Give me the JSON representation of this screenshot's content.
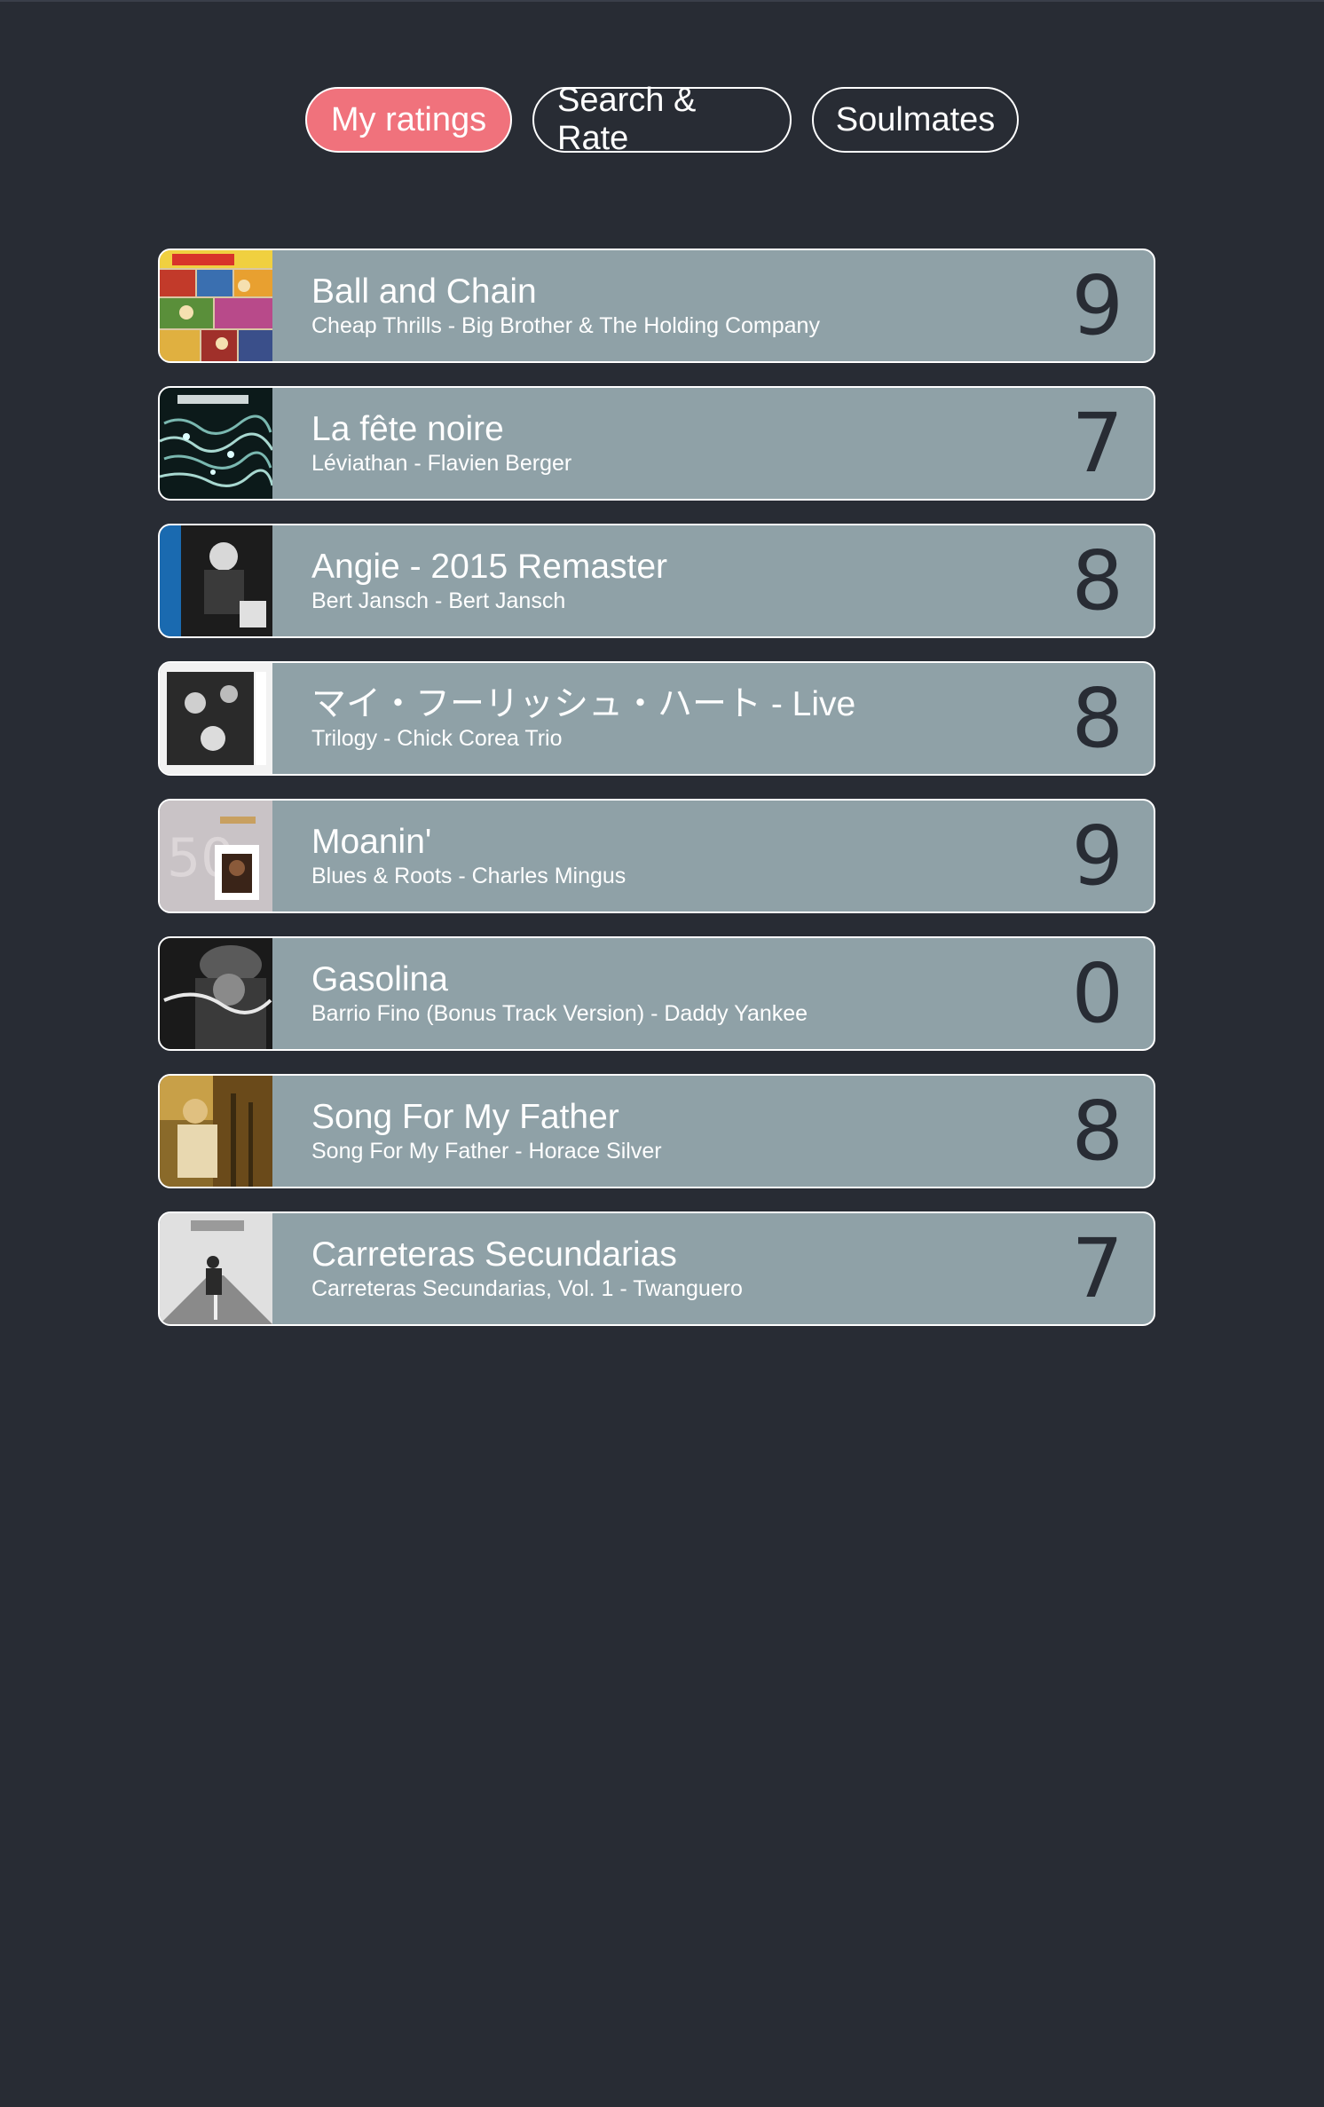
{
  "nav": {
    "tabs": [
      {
        "label": "My ratings",
        "active": true
      },
      {
        "label": "Search & Rate",
        "active": false
      },
      {
        "label": "Soulmates",
        "active": false
      }
    ]
  },
  "ratings": [
    {
      "title": "Ball and Chain",
      "album": "Cheap Thrills",
      "artist": "Big Brother & The Holding Company",
      "subtitle": "Cheap Thrills - Big Brother & The Holding Company",
      "rating": "9"
    },
    {
      "title": "La fête noire",
      "album": "Léviathan",
      "artist": "Flavien Berger",
      "subtitle": "Léviathan - Flavien Berger",
      "rating": "7"
    },
    {
      "title": "Angie - 2015 Remaster",
      "album": "Bert Jansch",
      "artist": "Bert Jansch",
      "subtitle": "Bert Jansch - Bert Jansch",
      "rating": "8"
    },
    {
      "title": "マイ・フーリッシュ・ハート - Live",
      "album": "Trilogy",
      "artist": "Chick Corea Trio",
      "subtitle": "Trilogy - Chick Corea Trio",
      "rating": "8"
    },
    {
      "title": "Moanin'",
      "album": "Blues & Roots",
      "artist": "Charles Mingus",
      "subtitle": "Blues & Roots - Charles Mingus",
      "rating": "9"
    },
    {
      "title": "Gasolina",
      "album": "Barrio Fino (Bonus Track Version)",
      "artist": "Daddy Yankee",
      "subtitle": "Barrio Fino (Bonus Track Version) - Daddy Yankee",
      "rating": "0"
    },
    {
      "title": "Song For My Father",
      "album": "Song For My Father",
      "artist": "Horace Silver",
      "subtitle": "Song For My Father - Horace Silver",
      "rating": "8"
    },
    {
      "title": "Carreteras Secundarias",
      "album": "Carreteras Secundarias, Vol. 1",
      "artist": "Twanguero",
      "subtitle": "Carreteras Secundarias, Vol. 1 - Twanguero",
      "rating": "7"
    }
  ],
  "colors": {
    "background": "#282c34",
    "active_tab": "#f0727c",
    "row": "#8fa1a7"
  }
}
